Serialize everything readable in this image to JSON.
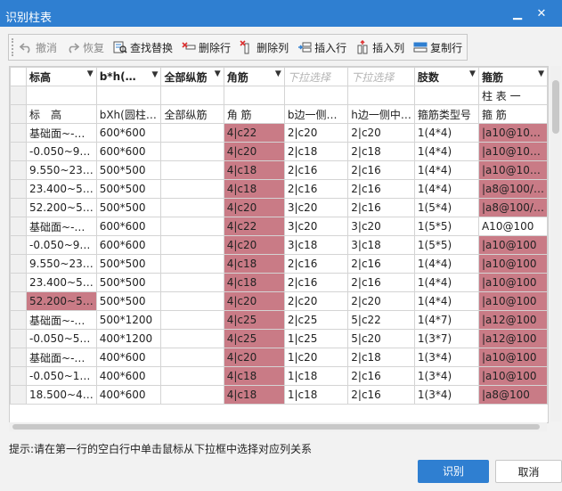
{
  "window": {
    "title": "识别柱表",
    "minimize": "▁",
    "close": "✕"
  },
  "toolbar": [
    {
      "label": "撤消",
      "icon": "undo-icon",
      "enabled": false
    },
    {
      "label": "恢复",
      "icon": "redo-icon",
      "enabled": false
    },
    {
      "label": "查找替换",
      "icon": "find-replace-icon",
      "enabled": true
    },
    {
      "label": "删除行",
      "icon": "delete-row-icon",
      "enabled": true
    },
    {
      "label": "删除列",
      "icon": "delete-column-icon",
      "enabled": true
    },
    {
      "label": "插入行",
      "icon": "insert-row-icon",
      "enabled": true
    },
    {
      "label": "插入列",
      "icon": "insert-column-icon",
      "enabled": true
    },
    {
      "label": "复制行",
      "icon": "copy-row-icon",
      "enabled": true
    }
  ],
  "grid": {
    "header": [
      {
        "label": "标高",
        "dropdown": true,
        "placeholder": false
      },
      {
        "label": "b*h(…",
        "dropdown": true,
        "placeholder": false
      },
      {
        "label": "全部纵筋",
        "dropdown": true,
        "placeholder": false
      },
      {
        "label": "角筋",
        "dropdown": true,
        "placeholder": false
      },
      {
        "label": "下拉选择",
        "dropdown": true,
        "placeholder": true
      },
      {
        "label": "下拉选择",
        "dropdown": true,
        "placeholder": true
      },
      {
        "label": "肢数",
        "dropdown": true,
        "placeholder": false
      },
      {
        "label": "箍筋",
        "dropdown": true,
        "placeholder": false
      }
    ],
    "extra_row": [
      "",
      "",
      "",
      "",
      "",
      "",
      "",
      "柱 表 一"
    ],
    "rows": [
      [
        "标　高",
        "bXh(圆柱…",
        "全部纵筋",
        "角 筋",
        "b边一侧…",
        "h边一侧中…",
        "箍筋类型号",
        "箍 筋"
      ],
      [
        "基础面~-…",
        "600*600",
        "",
        "4|c22",
        "2|c20",
        "2|c20",
        "1(4*4)",
        "|a10@10…"
      ],
      [
        "-0.050~9…",
        "600*600",
        "",
        "4|c20",
        "2|c18",
        "2|c18",
        "1(4*4)",
        "|a10@10…"
      ],
      [
        "9.550~23…",
        "500*500",
        "",
        "4|c18",
        "2|c16",
        "2|c16",
        "1(4*4)",
        "|a10@10…"
      ],
      [
        "23.400~5…",
        "500*500",
        "",
        "4|c18",
        "2|c16",
        "2|c16",
        "1(4*4)",
        "|a8@100/…"
      ],
      [
        "52.200~5…",
        "500*500",
        "",
        "4|c20",
        "3|c20",
        "2|c16",
        "1(5*4)",
        "|a8@100/…"
      ],
      [
        "基础面~-…",
        "600*600",
        "",
        "4|c22",
        "3|c20",
        "3|c20",
        "1(5*5)",
        "A10@100"
      ],
      [
        "-0.050~9…",
        "600*600",
        "",
        "4|c20",
        "3|c18",
        "3|c18",
        "1(5*5)",
        "|a10@100"
      ],
      [
        "9.550~23…",
        "500*500",
        "",
        "4|c18",
        "2|c16",
        "2|c16",
        "1(4*4)",
        "|a10@100"
      ],
      [
        "23.400~5…",
        "500*500",
        "",
        "4|c18",
        "2|c16",
        "2|c16",
        "1(4*4)",
        "|a10@100"
      ],
      [
        "52.200~5…",
        "500*500",
        "",
        "4|c20",
        "2|c20",
        "2|c20",
        "1(4*4)",
        "|a10@100"
      ],
      [
        "基础面~-…",
        "500*1200",
        "",
        "4|c25",
        "2|c25",
        "5|c22",
        "1(4*7)",
        "|a12@100"
      ],
      [
        "-0.050~5…",
        "400*1200",
        "",
        "4|c25",
        "1|c25",
        "5|c20",
        "1(3*7)",
        "|a12@100"
      ],
      [
        "基础面~-…",
        "400*600",
        "",
        "4|c20",
        "1|c20",
        "2|c18",
        "1(3*4)",
        "|a10@100"
      ],
      [
        "-0.050~1…",
        "400*600",
        "",
        "4|c18",
        "1|c18",
        "2|c16",
        "1(3*4)",
        "|a10@100"
      ],
      [
        "18.500~4…",
        "400*600",
        "",
        "4|c18",
        "1|c18",
        "2|c16",
        "1(3*4)",
        "|a8@100"
      ]
    ],
    "highlighted": [
      [
        1,
        3
      ],
      [
        1,
        7
      ],
      [
        2,
        3
      ],
      [
        2,
        7
      ],
      [
        3,
        3
      ],
      [
        3,
        7
      ],
      [
        4,
        3
      ],
      [
        4,
        7
      ],
      [
        5,
        3
      ],
      [
        5,
        7
      ],
      [
        6,
        3
      ],
      [
        7,
        3
      ],
      [
        7,
        7
      ],
      [
        8,
        3
      ],
      [
        8,
        7
      ],
      [
        9,
        3
      ],
      [
        9,
        7
      ],
      [
        10,
        0
      ],
      [
        10,
        3
      ],
      [
        10,
        7
      ],
      [
        11,
        3
      ],
      [
        11,
        7
      ],
      [
        12,
        3
      ],
      [
        12,
        7
      ],
      [
        13,
        3
      ],
      [
        13,
        7
      ],
      [
        14,
        3
      ],
      [
        14,
        7
      ],
      [
        15,
        3
      ],
      [
        15,
        7
      ]
    ],
    "highlight_color": "#c97b86"
  },
  "hint": "提示:请在第一行的空白行中单击鼠标从下拉框中选择对应列关系",
  "buttons": {
    "ok": "识别",
    "cancel": "取消"
  }
}
